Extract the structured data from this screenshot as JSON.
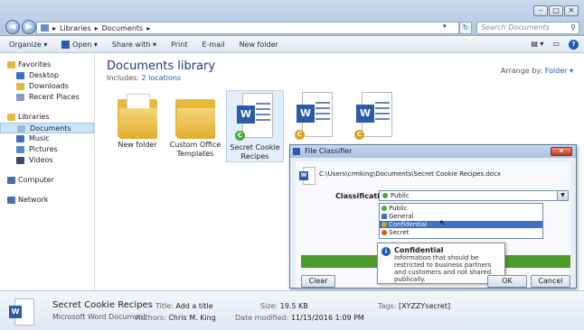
{
  "address": {
    "crumbs": [
      "Libraries",
      "Documents"
    ],
    "search_placeholder": "Search Documents"
  },
  "window_controls": [
    "–",
    "□",
    "✕"
  ],
  "toolbar": {
    "organize": "Organize ▾",
    "open": "Open ▾",
    "share_with": "Share with ▾",
    "print": "Print",
    "email": "E-mail",
    "new_folder": "New folder"
  },
  "sidebar": {
    "favorites": "Favorites",
    "desktop": "Desktop",
    "downloads": "Downloads",
    "recent_places": "Recent Places",
    "libraries": "Libraries",
    "documents": "Documents",
    "music": "Music",
    "pictures": "Pictures",
    "videos": "Videos",
    "computer": "Computer",
    "network": "Network"
  },
  "library": {
    "title": "Documents library",
    "includes_label": "Includes:",
    "includes_link": "2 locations",
    "arrange_label": "Arrange by:",
    "arrange_value": "Folder ▾"
  },
  "files": [
    {
      "label": "New folder"
    },
    {
      "label": "Custom Office Templates"
    },
    {
      "label": "Secret Cookie Recipes"
    },
    {
      "label": ""
    },
    {
      "label": ""
    }
  ],
  "dialog": {
    "title": "File Classifier",
    "close": "✕",
    "path": "C:\\Users\\crmking\\Documents\\Secret Cookie Recipes.docx",
    "classification_label": "Classification",
    "selected": "Public",
    "options": [
      {
        "label": "Public",
        "color": "#4aa83a"
      },
      {
        "label": "General",
        "color": "#3b6fc4"
      },
      {
        "label": "Confidential",
        "color": "#e0a020"
      },
      {
        "label": "Secret",
        "color": "#d25a1e"
      }
    ],
    "tooltip_title": "Confidential",
    "tooltip_body": "Information that should be restricted to business partners and customers and not shared publically.",
    "clear": "Clear",
    "ok": "OK",
    "cancel": "Cancel"
  },
  "details": {
    "name": "Secret Cookie Recipes",
    "type": "Microsoft Word Document",
    "title_k": "Title:",
    "title_v": "Add a title",
    "authors_k": "Authors:",
    "authors_v": "Chris M. King",
    "size_k": "Size:",
    "size_v": "19.5 KB",
    "modified_k": "Date modified:",
    "modified_v": "11/15/2016 1:09 PM",
    "tags_k": "Tags:",
    "tags_v": "[XYZZYsecret]"
  },
  "colors": {
    "accent": "#1e5bb0",
    "green_bar": "#4c9a2a"
  }
}
